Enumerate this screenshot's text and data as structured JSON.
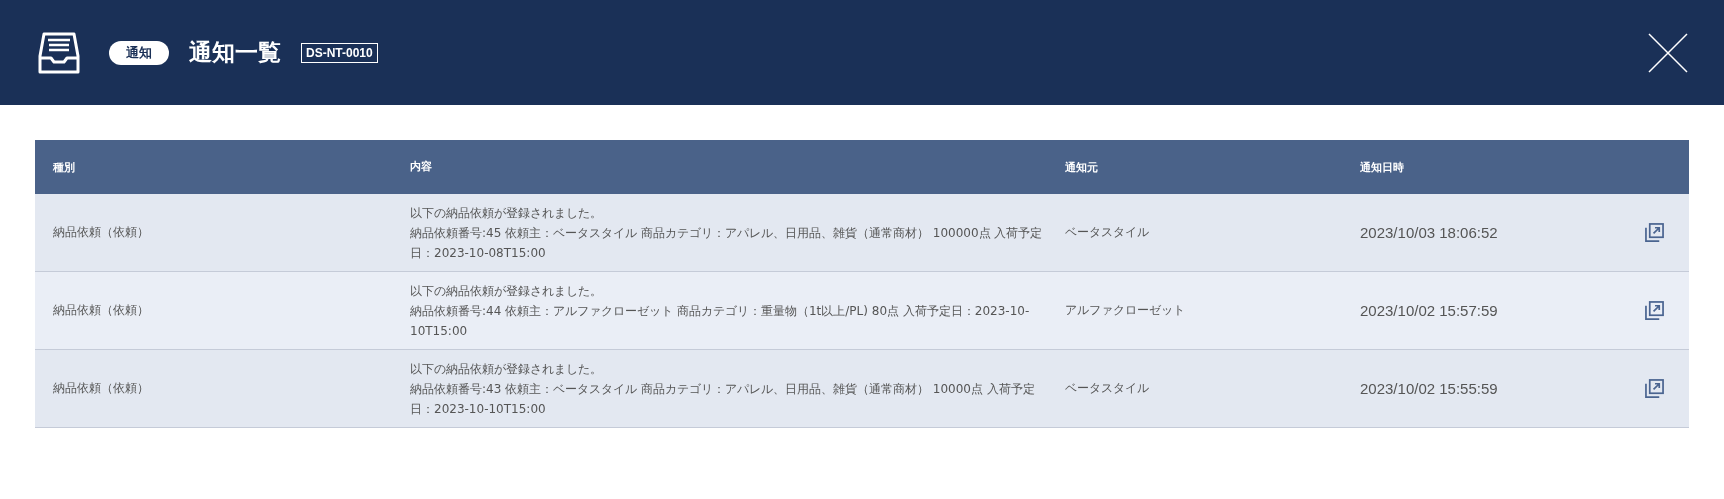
{
  "header": {
    "badge": "通知",
    "title": "通知一覧",
    "screen_code": "DS-NT-0010"
  },
  "table": {
    "columns": [
      "種別",
      "内容",
      "通知元",
      "通知日時"
    ],
    "rows": [
      {
        "type": "納品依頼（依頼）",
        "message": "以下の納品依頼が登録されました。",
        "details": "納品依頼番号:45 依頼主：ベータスタイル 商品カテゴリ：アパレル、日用品、雑貨（通常商材） 100000点 入荷予定日：2023-10-08T15:00",
        "source": "ベータスタイル",
        "datetime": "2023/10/03 18:06:52"
      },
      {
        "type": "納品依頼（依頼）",
        "message": "以下の納品依頼が登録されました。",
        "details": "納品依頼番号:44 依頼主：アルファクローゼット 商品カテゴリ：重量物（1t以上/PL) 80点 入荷予定日：2023-10-10T15:00",
        "source": "アルファクローゼット",
        "datetime": "2023/10/02 15:57:59"
      },
      {
        "type": "納品依頼（依頼）",
        "message": "以下の納品依頼が登録されました。",
        "details": "納品依頼番号:43 依頼主：ベータスタイル 商品カテゴリ：アパレル、日用品、雑貨（通常商材） 10000点 入荷予定日：2023-10-10T15:00",
        "source": "ベータスタイル",
        "datetime": "2023/10/02 15:55:59"
      }
    ]
  }
}
